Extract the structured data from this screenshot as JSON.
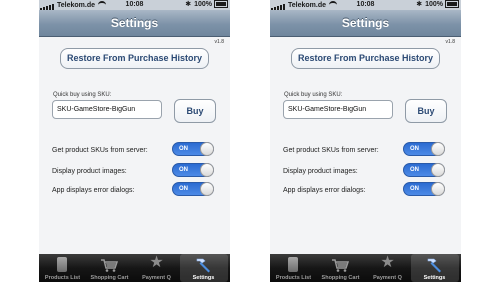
{
  "screens": [
    {
      "status": {
        "carrier": "Telekom.de",
        "time": "10:08",
        "battery": "100%"
      },
      "nav_title": "Settings",
      "version": "v1.8",
      "restore_label": "Restore From Purchase History",
      "quick_buy_label": "Quick buy using SKU:",
      "quick_buy_value": "SKU-GameStore-BigGun",
      "buy_label": "Buy",
      "settings": [
        {
          "label": "Get product SKUs from server:",
          "state": "ON"
        },
        {
          "label": "Display product images:",
          "state": "ON"
        },
        {
          "label": "App displays error dialogs:",
          "state": "ON"
        }
      ],
      "tabs": [
        {
          "label": "Products List",
          "icon": "phone-icon"
        },
        {
          "label": "Shopping Cart",
          "icon": "cart-icon"
        },
        {
          "label": "Payment Q",
          "icon": "star-icon"
        },
        {
          "label": "Settings",
          "icon": "hammer-icon",
          "active": true
        }
      ]
    },
    {
      "status": {
        "carrier": "Telekom.de",
        "time": "10:08",
        "battery": "100%"
      },
      "nav_title": "Settings",
      "version": "v1.8",
      "restore_label": "Restore From Purchase History",
      "quick_buy_label": "Quick buy using SKU:",
      "quick_buy_value": "SKU-GameStore-BigGun",
      "buy_label": "Buy",
      "settings": [
        {
          "label": "Get product SKUs from server:",
          "state": "ON"
        },
        {
          "label": "Display product images:",
          "state": "ON"
        },
        {
          "label": "App displays error dialogs:",
          "state": "ON"
        }
      ],
      "tabs": [
        {
          "label": "Products List",
          "icon": "phone-icon"
        },
        {
          "label": "Shopping Cart",
          "icon": "cart-icon"
        },
        {
          "label": "Payment Q",
          "icon": "star-icon"
        },
        {
          "label": "Settings",
          "icon": "hammer-icon",
          "active": true
        }
      ]
    }
  ],
  "colors": {
    "nav_gradient_top": "#a9b7c6",
    "nav_gradient_bottom": "#6f869d",
    "toggle_on": "#2b6bd1",
    "button_text": "#2c4a74",
    "tabbar_bg": "#161616"
  }
}
